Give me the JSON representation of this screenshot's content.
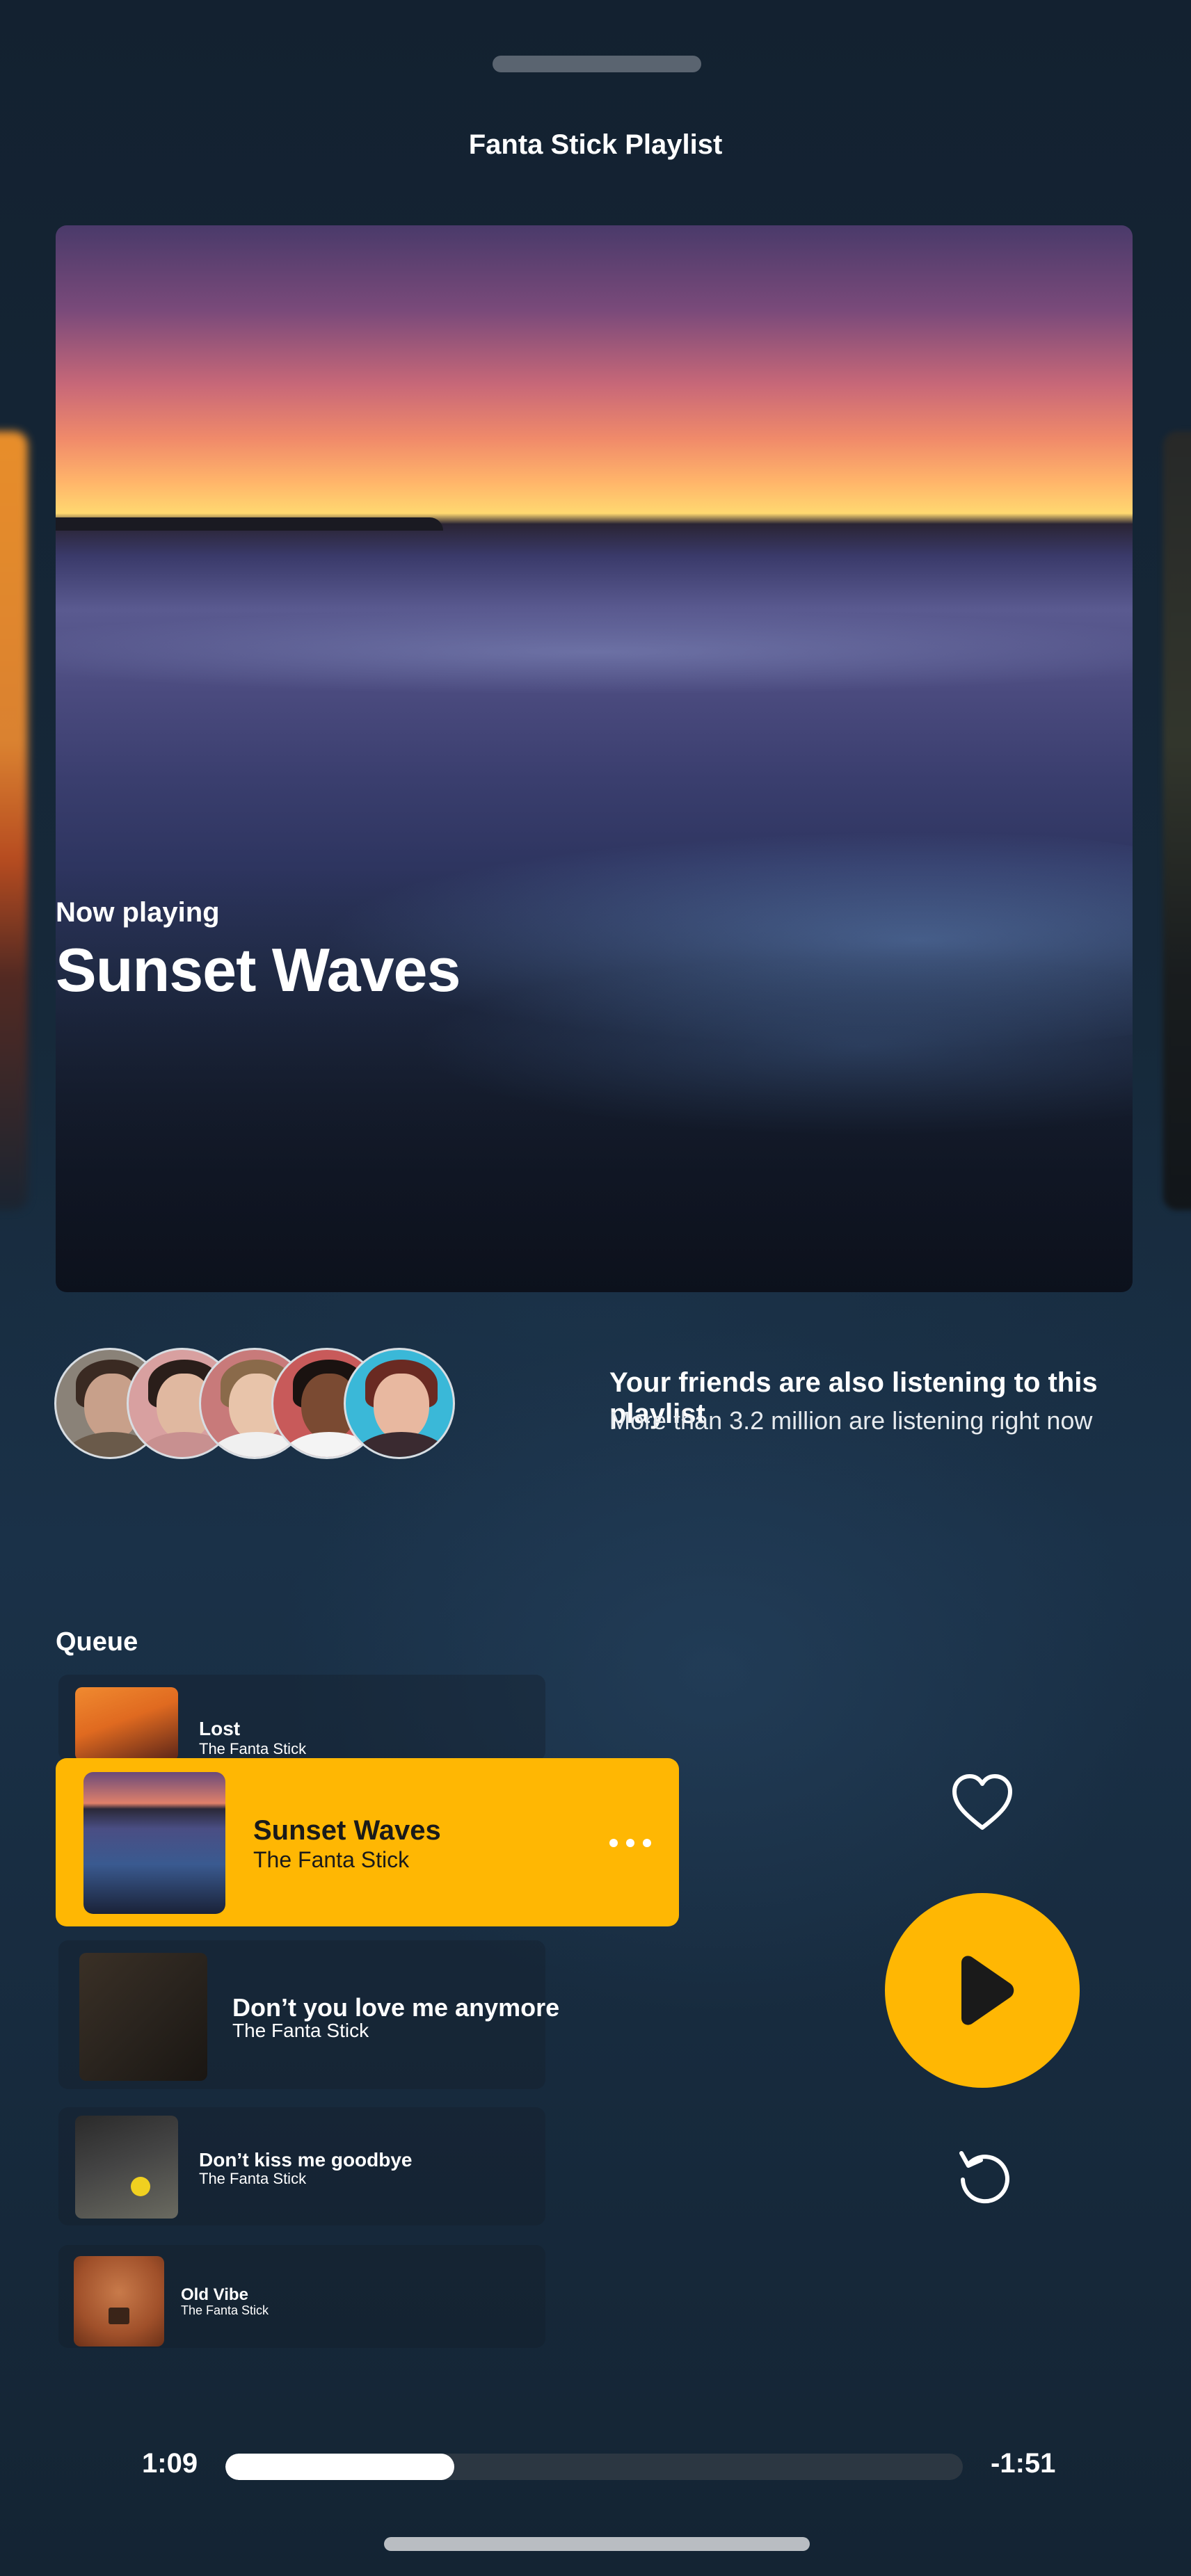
{
  "header": {
    "title": "Fanta Stick Playlist"
  },
  "now_playing": {
    "label": "Now playing",
    "title": "Sunset Waves"
  },
  "friends": {
    "title": "Your friends are also listening to this playlist",
    "subtitle": "More than 3.2 million are listening right now"
  },
  "queue": {
    "label": "Queue",
    "items": [
      {
        "title": "Lost",
        "artist": "The Fanta Stick"
      },
      {
        "title": "Sunset Waves",
        "artist": "The Fanta Stick"
      },
      {
        "title": "Don’t you love me anymore",
        "artist": "The Fanta Stick"
      },
      {
        "title": "Don’t kiss me goodbye",
        "artist": "The Fanta Stick"
      },
      {
        "title": "Old Vibe",
        "artist": "The Fanta Stick"
      }
    ],
    "active_index": 1
  },
  "controls": {
    "like_icon": "heart-icon",
    "play_icon": "play-icon",
    "replay_icon": "replay-icon",
    "more_icon": "more-dots-icon"
  },
  "progress": {
    "elapsed": "1:09",
    "remaining": "-1:51",
    "fraction": 0.31
  },
  "colors": {
    "accent": "#ffb703",
    "background": "#14202c",
    "track": "#2c3742"
  }
}
